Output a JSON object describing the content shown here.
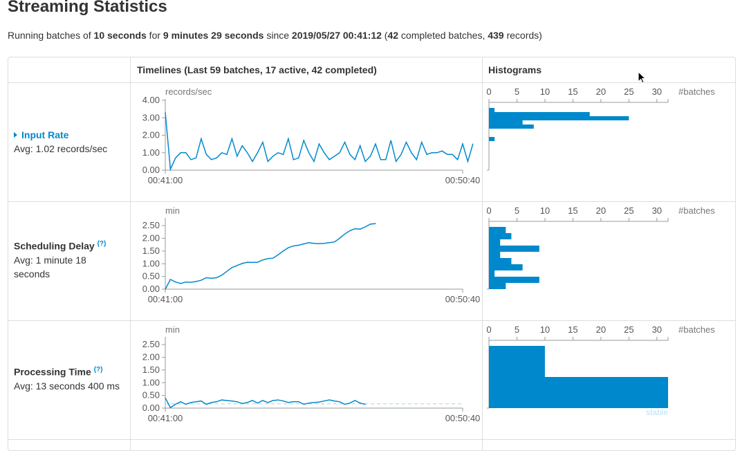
{
  "page": {
    "title": "Streaming Statistics",
    "summary": {
      "p1": "Running batches of ",
      "batch_interval": "10 seconds",
      "p2": " for ",
      "duration": "9 minutes 29 seconds",
      "p3": " since ",
      "start_time": "2019/05/27 00:41:12",
      "p4": " (",
      "completed_batches": "42",
      "p5": " completed batches, ",
      "records": "439",
      "p6": " records)"
    }
  },
  "table": {
    "col_timelines": "Timelines (Last 59 batches, 17 active, 42 completed)",
    "col_histograms": "Histograms"
  },
  "rows": [
    {
      "name": "Input Rate",
      "avg": "Avg: 1.02 records/sec"
    },
    {
      "name": "Scheduling Delay",
      "help": "(?)",
      "avg": "Avg: 1 minute 18",
      "avg2": "seconds"
    },
    {
      "name": "Processing Time",
      "help": "(?)",
      "avg": "Avg: 13 seconds 400 ms"
    }
  ],
  "colors": {
    "series": "#0088cc",
    "stable": "#bfe0f0",
    "grid": "#ddd",
    "axis": "#999"
  },
  "chart_data": [
    {
      "type": "line",
      "unit_label": "records/sec",
      "x_ticks": [
        "00:41:00",
        "00:50:40"
      ],
      "y_ticks": [
        "0.00",
        "1.00",
        "2.00",
        "3.00",
        "4.00"
      ],
      "ylim": [
        0,
        4
      ],
      "values": [
        3.3,
        0.05,
        0.7,
        1.0,
        1.0,
        0.6,
        0.7,
        1.8,
        0.9,
        0.6,
        0.7,
        1.0,
        0.9,
        1.8,
        0.8,
        1.4,
        1.0,
        0.5,
        1.0,
        1.6,
        0.5,
        0.8,
        1.0,
        0.9,
        1.8,
        0.6,
        0.7,
        1.7,
        1.0,
        0.5,
        1.5,
        1.0,
        0.6,
        0.8,
        1.0,
        1.6,
        0.9,
        0.6,
        1.4,
        0.5,
        0.8,
        1.5,
        0.6,
        0.6,
        1.7,
        0.5,
        0.9,
        1.6,
        1.0,
        0.6,
        1.6,
        0.9,
        1.0,
        1.0,
        1.1,
        0.9,
        0.9,
        0.6,
        1.5,
        0.5,
        1.5
      ]
    },
    {
      "type": "bar",
      "orientation": "horizontal",
      "x_ticks": [
        0,
        5,
        10,
        15,
        20,
        25,
        30
      ],
      "xlim": [
        0,
        32
      ],
      "axis_label": "#batches",
      "bin_range": [
        0,
        4
      ],
      "bins": [
        0,
        0,
        0,
        0,
        0,
        0,
        0,
        1,
        0,
        0,
        8,
        6,
        25,
        18,
        1
      ]
    },
    {
      "type": "line",
      "unit_label": "min",
      "x_ticks": [
        "00:41:00",
        "00:50:40"
      ],
      "y_ticks": [
        "0.00",
        "0.50",
        "1.00",
        "1.50",
        "2.00",
        "2.50"
      ],
      "ylim": [
        0,
        2.75
      ],
      "values": [
        0.0,
        0.38,
        0.28,
        0.22,
        0.28,
        0.27,
        0.3,
        0.35,
        0.45,
        0.43,
        0.45,
        0.55,
        0.7,
        0.85,
        0.93,
        1.01,
        1.06,
        1.05,
        1.06,
        1.15,
        1.2,
        1.22,
        1.35,
        1.5,
        1.63,
        1.7,
        1.73,
        1.78,
        1.83,
        1.8,
        1.79,
        1.8,
        1.83,
        1.86,
        2.0,
        2.17,
        2.3,
        2.38,
        2.36,
        2.45,
        2.56,
        2.58
      ]
    },
    {
      "type": "bar",
      "orientation": "horizontal",
      "x_ticks": [
        0,
        5,
        10,
        15,
        20,
        25,
        30
      ],
      "xlim": [
        0,
        32
      ],
      "axis_label": "#batches",
      "bin_range": [
        0,
        2.75
      ],
      "bins": [
        3,
        9,
        1,
        6,
        4,
        2,
        9,
        2,
        4,
        3
      ]
    },
    {
      "type": "line",
      "unit_label": "min",
      "x_ticks": [
        "00:41:00",
        "00:50:40"
      ],
      "y_ticks": [
        "0.00",
        "0.50",
        "1.00",
        "1.50",
        "2.00",
        "2.50"
      ],
      "ylim": [
        0,
        2.75
      ],
      "stable_value": 0.17,
      "values": [
        0.4,
        0.02,
        0.15,
        0.25,
        0.15,
        0.22,
        0.25,
        0.28,
        0.15,
        0.22,
        0.25,
        0.32,
        0.3,
        0.28,
        0.25,
        0.18,
        0.22,
        0.3,
        0.2,
        0.3,
        0.22,
        0.3,
        0.32,
        0.28,
        0.22,
        0.25,
        0.25,
        0.15,
        0.2,
        0.22,
        0.24,
        0.28,
        0.32,
        0.28,
        0.25,
        0.15,
        0.2,
        0.3,
        0.2,
        0.15
      ]
    },
    {
      "type": "bar",
      "orientation": "horizontal",
      "x_ticks": [
        0,
        5,
        10,
        15,
        20,
        25,
        30
      ],
      "xlim": [
        0,
        32
      ],
      "axis_label": "#batches",
      "bin_range": [
        0,
        2.75
      ],
      "bins": [
        32,
        10
      ],
      "stable_label": "stable"
    }
  ]
}
